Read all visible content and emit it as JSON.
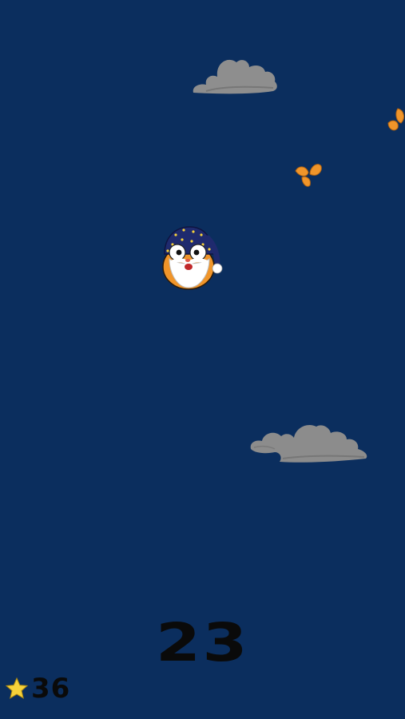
{
  "colors": {
    "sky": "#0b2e5e",
    "cloud": "#8c8c8c",
    "cloud_shadow": "#6e6e6e",
    "leaf": "#f0952a",
    "star": "#f7d23a",
    "text": "#0a0a0a"
  },
  "game": {
    "score": "23",
    "stars_collected": "36"
  },
  "icons": {
    "player": "wizard-hamster-icon",
    "star": "star-icon",
    "obstacle": "cloud-icon",
    "pickup": "leaf-icon"
  }
}
